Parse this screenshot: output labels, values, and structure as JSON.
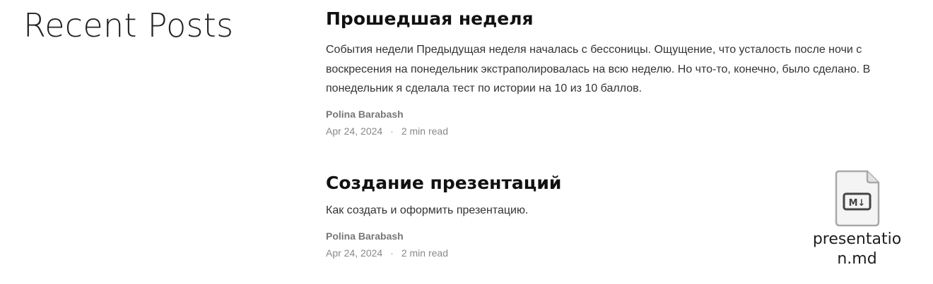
{
  "section": {
    "title": "Recent Posts"
  },
  "posts": [
    {
      "title": "Прошедшая неделя",
      "excerpt": "События недели Предыдущая неделя началась с бессоницы. Ощущение, что усталость после ночи с воскресения на понедельник экстраполировалась на всю неделю. Но что-то, конечно, было сделано. В понедельник я сделала тест по истории на 10 из 10 баллов.",
      "author": "Polina Barabash",
      "date": "Apr 24, 2024",
      "read_time": "2 min read"
    },
    {
      "title": "Создание презентаций",
      "excerpt": "Как создать и оформить презентацию.",
      "author": "Polina Barabash",
      "date": "Apr 24, 2024",
      "read_time": "2 min read"
    }
  ],
  "desktop_file": {
    "name": "presentation.md",
    "icon": "markdown-file-icon",
    "badge": "M↓"
  },
  "meta_separator": "·"
}
